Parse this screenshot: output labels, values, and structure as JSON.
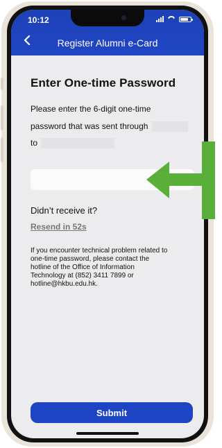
{
  "status_bar": {
    "time": "10:12"
  },
  "nav": {
    "back_icon": "chevron-left-icon",
    "title": "Register Alumni e-Card"
  },
  "main": {
    "heading": "Enter One-time Password",
    "line1": "Please enter the 6-digit one-time",
    "line2": "password that was sent through",
    "line3": "to",
    "otp_value": "",
    "didnt_receive": "Didn’t receive it?",
    "resend": "Resend in 52s",
    "help_text": "If you encounter technical problem related to\none-time password, please contact the\nhotline of the Office of Information\nTechnology at (852) 3411 7899 or\nhotline@hkbu.edu.hk."
  },
  "footer": {
    "submit_label": "Submit"
  },
  "colors": {
    "header": "#2146c4",
    "submit": "#1d45c3",
    "arrow": "#5aae3a",
    "background": "#ececee"
  }
}
